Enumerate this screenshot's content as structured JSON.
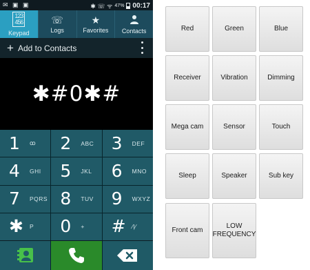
{
  "status_bar": {
    "left_icons": "✉ ▣ ▣",
    "right_icons": "✱ ☏ ᯤ",
    "battery_percent": "47%",
    "battery_level": 0.47,
    "time": "00:17"
  },
  "tabs": [
    {
      "label": "Keypad",
      "icon": "keypad-icon",
      "active": true
    },
    {
      "label": "Logs",
      "icon": "logs-icon",
      "active": false
    },
    {
      "label": "Favorites",
      "icon": "star-icon",
      "active": false
    },
    {
      "label": "Contacts",
      "icon": "person-icon",
      "active": false
    }
  ],
  "add_contacts": {
    "plus": "+",
    "label": "Add to Contacts"
  },
  "dialed_number": "✱#0✱#",
  "keypad": [
    {
      "digit": "1",
      "letters": "ꝏ"
    },
    {
      "digit": "2",
      "letters": "ABC"
    },
    {
      "digit": "3",
      "letters": "DEF"
    },
    {
      "digit": "4",
      "letters": "GHI"
    },
    {
      "digit": "5",
      "letters": "JKL"
    },
    {
      "digit": "6",
      "letters": "MNO"
    },
    {
      "digit": "7",
      "letters": "PQRS"
    },
    {
      "digit": "8",
      "letters": "TUV"
    },
    {
      "digit": "9",
      "letters": "WXYZ"
    },
    {
      "digit": "✱",
      "letters": "P"
    },
    {
      "digit": "0",
      "letters": "+"
    },
    {
      "digit": "#",
      "letters": "⁄|⁄"
    }
  ],
  "action_icons": [
    "contact-card-icon",
    "phone-icon",
    "backspace-icon"
  ],
  "test_menu": [
    {
      "label": "Red"
    },
    {
      "label": "Green"
    },
    {
      "label": "Blue"
    },
    {
      "label": "Receiver"
    },
    {
      "label": "Vibration"
    },
    {
      "label": "Dimming"
    },
    {
      "label": "Mega cam"
    },
    {
      "label": "Sensor"
    },
    {
      "label": "Touch"
    },
    {
      "label": "Sleep"
    },
    {
      "label": "Speaker"
    },
    {
      "label": "Sub key"
    },
    {
      "label": "Front cam"
    },
    {
      "label": "LOW FREQUENCY"
    }
  ],
  "colors": {
    "active_tab": "#2b9fc1",
    "tab_bar": "#1d4b5d",
    "keypad_key": "#205a67",
    "call_button": "#2a8a2a"
  }
}
